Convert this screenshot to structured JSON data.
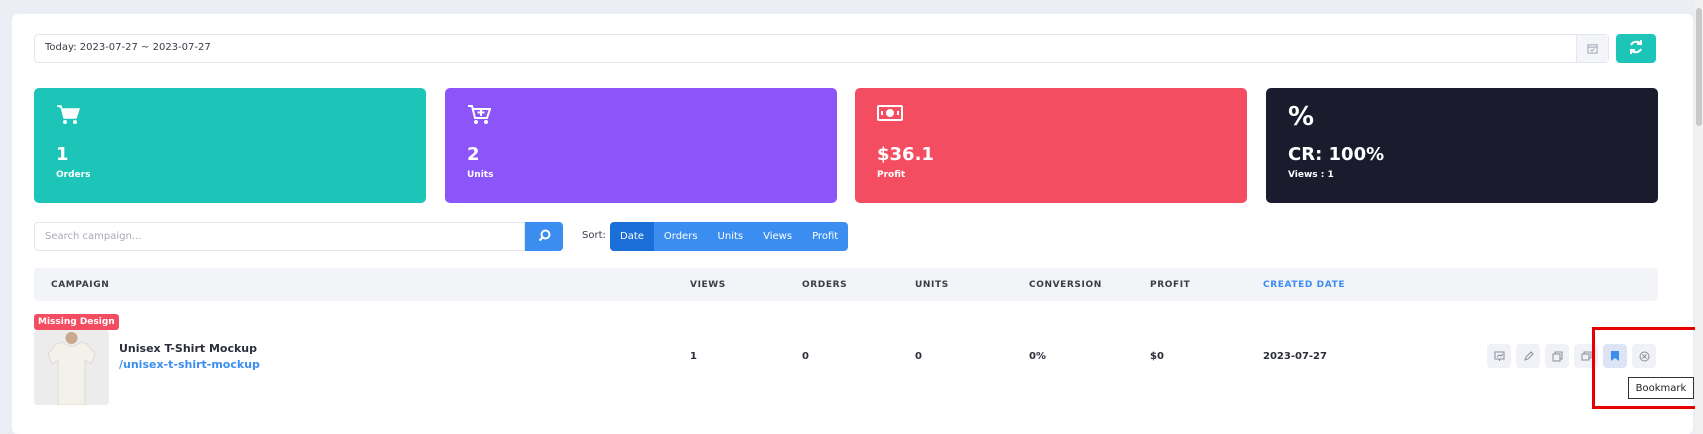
{
  "date_range": {
    "value": "Today: 2023-07-27 ~ 2023-07-27"
  },
  "stats": [
    {
      "value": "1",
      "label": "Orders",
      "icon": "cart-icon",
      "color": "#1dc4b8"
    },
    {
      "value": "2",
      "label": "Units",
      "icon": "cart-plus-icon",
      "color": "#8c55fa"
    },
    {
      "value": "$36.1",
      "label": "Profit",
      "icon": "money-icon",
      "color": "#f44d62"
    },
    {
      "value": "CR: 100%",
      "label": "Views : 1",
      "icon": "percent-icon",
      "icon_text": "%",
      "color": "#1a1c2e"
    }
  ],
  "search": {
    "placeholder": "Search campaign..."
  },
  "sort": {
    "label": "Sort:",
    "options": [
      "Date",
      "Orders",
      "Units",
      "Views",
      "Profit"
    ],
    "active": "Date"
  },
  "table": {
    "headers": [
      "CAMPAIGN",
      "VIEWS",
      "ORDERS",
      "UNITS",
      "CONVERSION",
      "PROFIT",
      "CREATED DATE"
    ],
    "rows": [
      {
        "badge": "Missing Design",
        "name": "Unisex T-Shirt Mockup",
        "slug": "/unisex-t-shirt-mockup",
        "views": "1",
        "orders": "0",
        "units": "0",
        "conversion": "0%",
        "profit": "$0",
        "created": "2023-07-27"
      }
    ]
  },
  "tooltip": {
    "text": "Bookmark"
  }
}
